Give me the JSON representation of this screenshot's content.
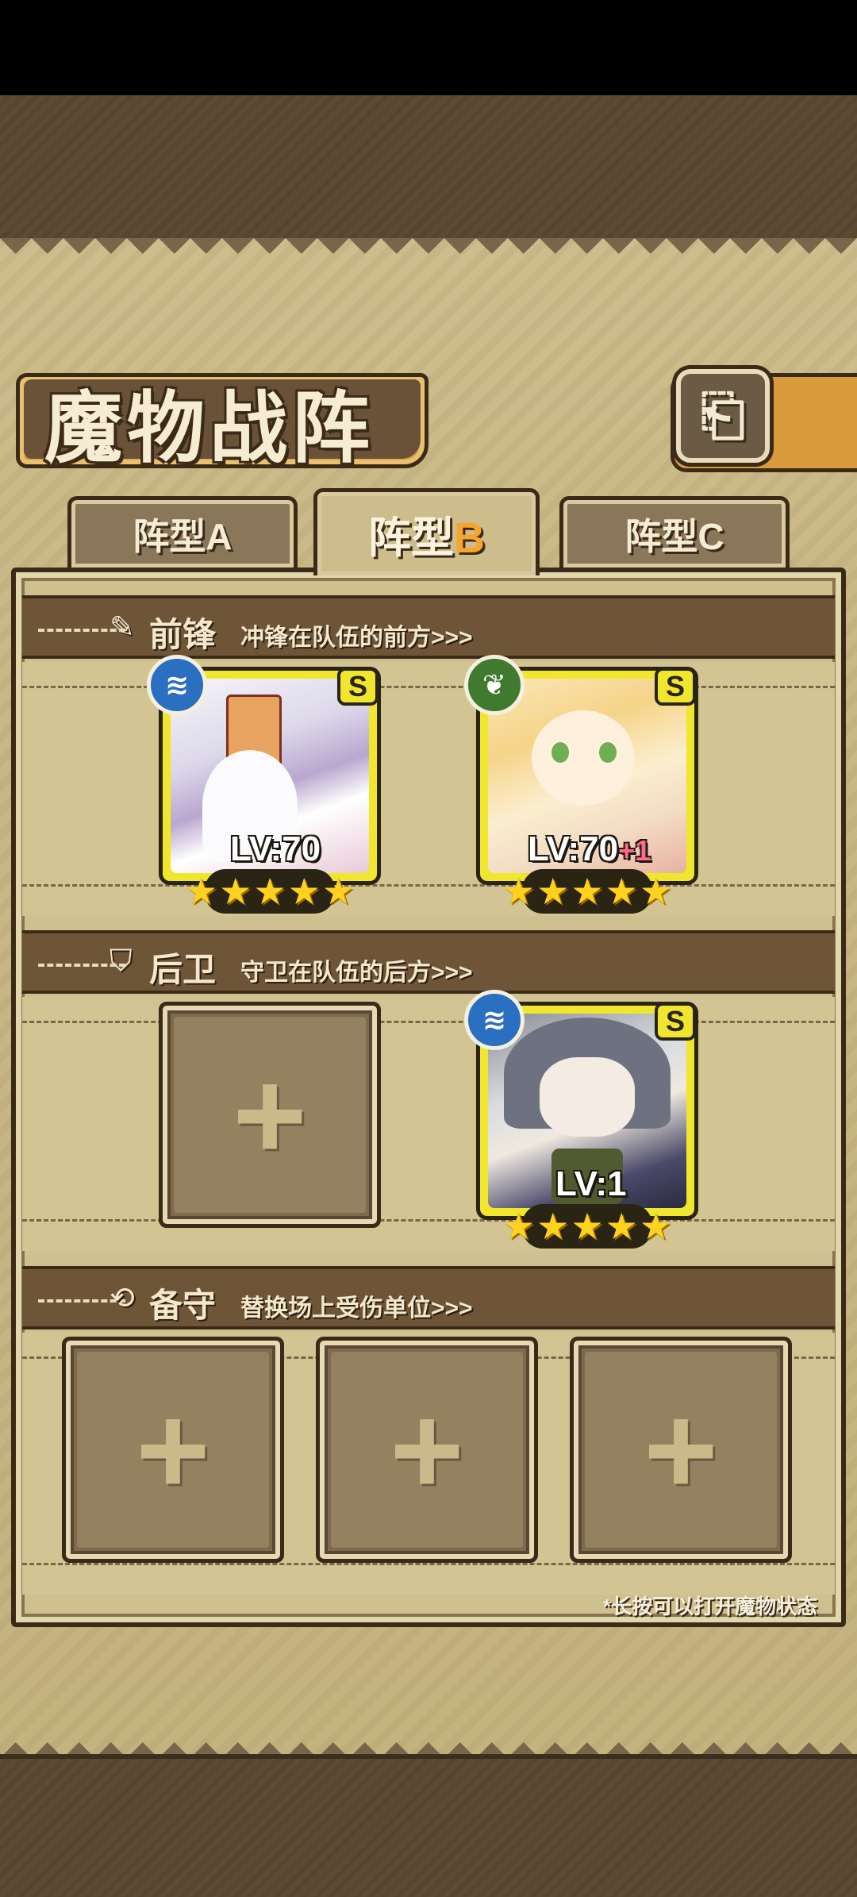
{
  "header": {
    "title": "魔物战阵",
    "back_glyph": "⎗"
  },
  "tabs": [
    {
      "label": "阵型",
      "letter": "A",
      "active": false
    },
    {
      "label": "阵型",
      "letter": "B",
      "active": true
    },
    {
      "label": "阵型",
      "letter": "C",
      "active": false
    }
  ],
  "sections": {
    "front": {
      "icon": "sword-icon",
      "title": "前锋",
      "subtitle": "冲锋在队伍的前方>>>"
    },
    "back": {
      "icon": "shield-icon",
      "title": "后卫",
      "subtitle": "守卫在队伍的后方>>>"
    },
    "reserve": {
      "icon": "swap-icon",
      "title": "备守",
      "subtitle": "替换场上受伤单位>>>"
    }
  },
  "front_cards": [
    {
      "element": "water",
      "element_glyph": "≋",
      "rank": "S",
      "level": "LV:70",
      "level_bonus": "",
      "stars": 5
    },
    {
      "element": "wind",
      "element_glyph": "❦",
      "rank": "S",
      "level": "LV:70",
      "level_bonus": "+1",
      "stars": 5
    }
  ],
  "back_cards": [
    {
      "element": "water",
      "element_glyph": "≋",
      "rank": "S",
      "level": "LV:1",
      "level_bonus": "",
      "stars": 5
    }
  ],
  "slot_plus": "+",
  "star_glyph": "★",
  "hint": "*长按可以打开魔物状态"
}
